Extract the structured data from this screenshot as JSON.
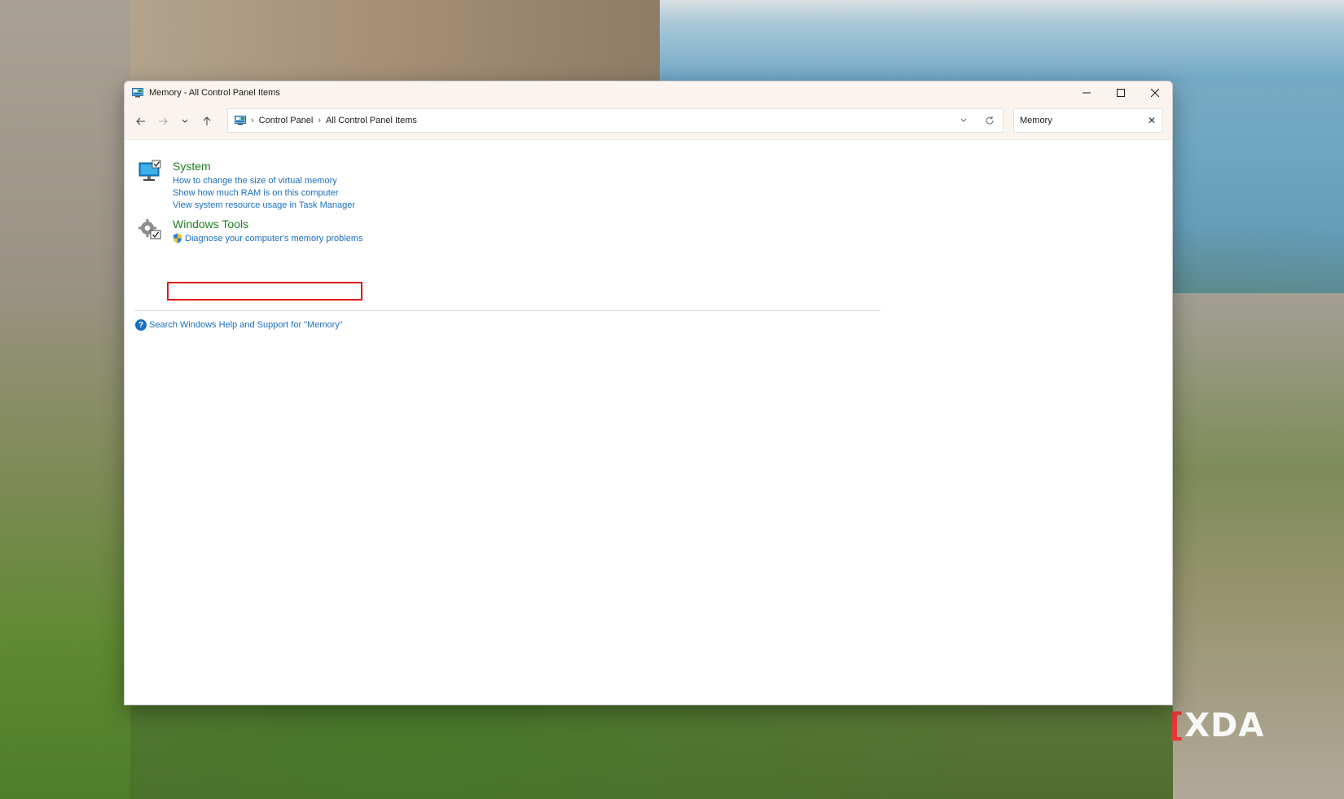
{
  "window": {
    "title": "Memory - All Control Panel Items"
  },
  "breadcrumb": {
    "items": [
      "Control Panel",
      "All Control Panel Items"
    ]
  },
  "search": {
    "value": "Memory"
  },
  "results": {
    "system": {
      "title": "System",
      "links": [
        "How to change the size of virtual memory",
        "Show how much RAM is on this computer",
        "View system resource usage in Task Manager"
      ]
    },
    "windows_tools": {
      "title": "Windows Tools",
      "links": [
        "Diagnose your computer's memory problems"
      ]
    },
    "help_link": "Search Windows Help and Support for \"Memory\""
  },
  "watermark": {
    "text": "XDA"
  },
  "colors": {
    "link": "#1a6ec2",
    "group_title": "#1e7e1e",
    "highlight": "#e01818",
    "titlebar": "#fbf4ee"
  }
}
